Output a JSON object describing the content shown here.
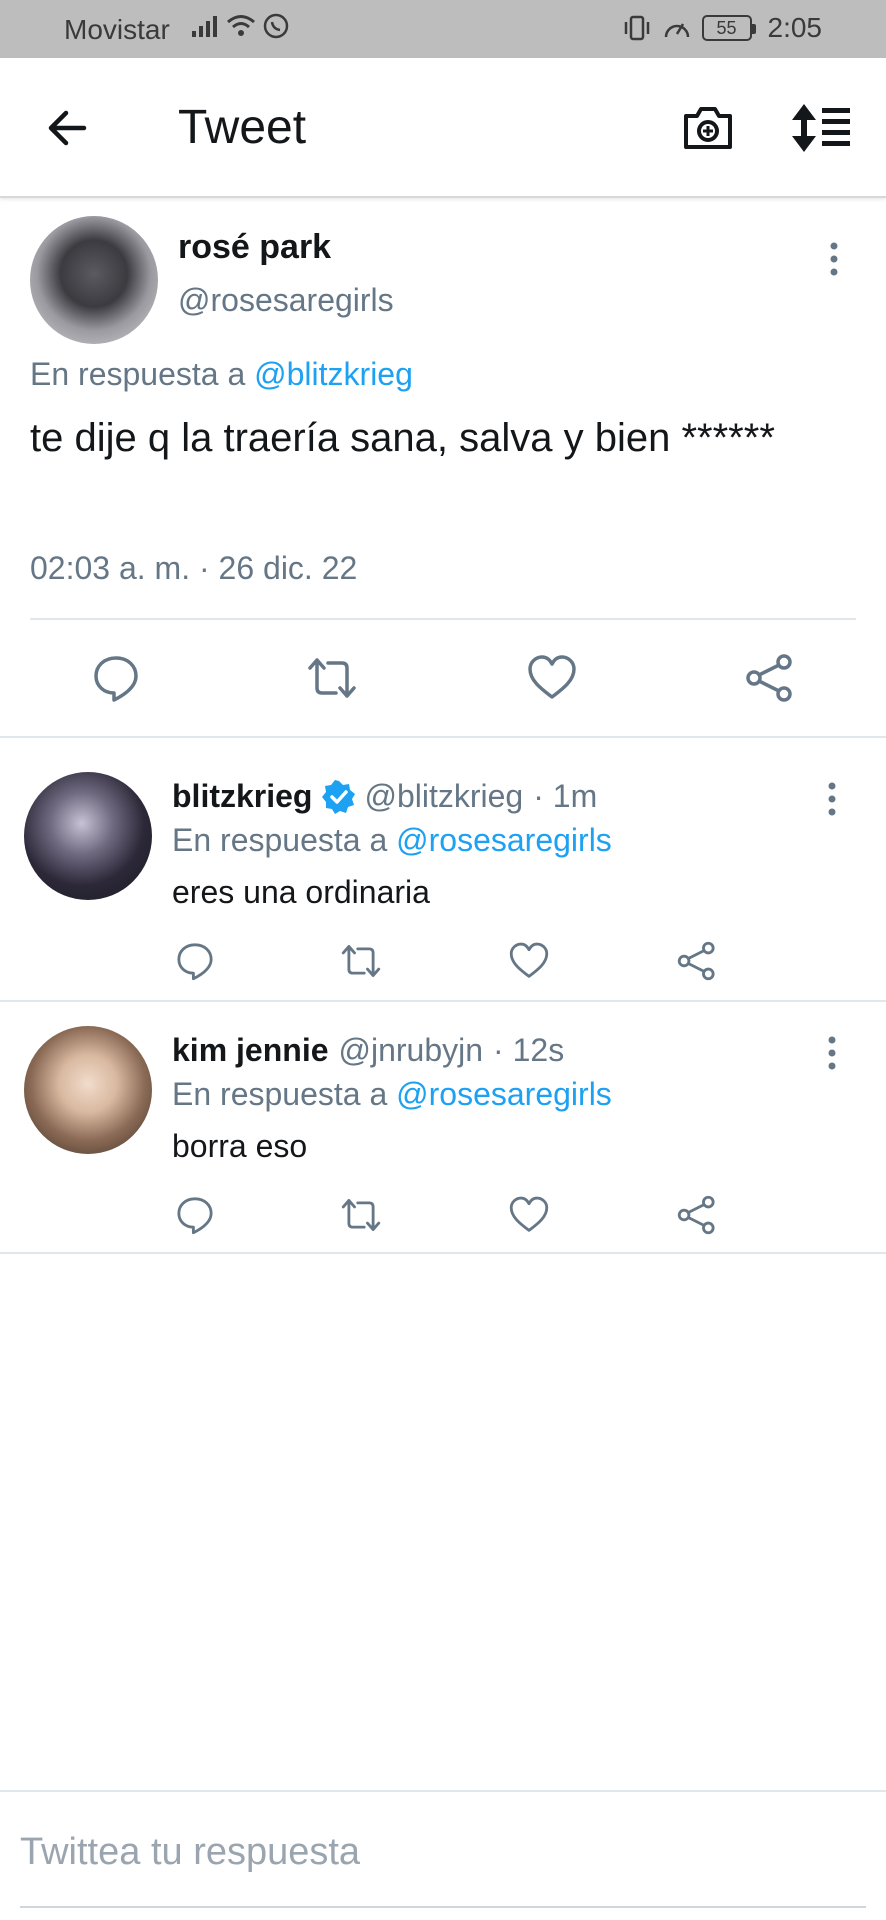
{
  "status_bar": {
    "carrier": "Movistar",
    "battery": "55",
    "time": "2:05",
    "icons": [
      "signal-icon",
      "wifi-icon",
      "whatsapp-icon",
      "vibrate-icon",
      "speed-icon",
      "battery-icon"
    ]
  },
  "header": {
    "title": "Tweet",
    "icons": [
      "back-arrow-icon",
      "camera-icon",
      "sort-icon"
    ]
  },
  "main_tweet": {
    "name": "rosé park",
    "handle": "@rosesaregirls",
    "reply_prefix": "En respuesta a",
    "reply_mention": "@blitzkrieg",
    "text": "te dije q la traería sana, salva y bien ******",
    "timestamp": "02:03 a. m. · 26 dic. 22",
    "actions": [
      "reply-icon",
      "retweet-icon",
      "like-icon",
      "share-icon"
    ]
  },
  "replies": [
    {
      "name": "blitzkrieg",
      "verified": true,
      "handle": "@blitzkrieg",
      "time": "· 1m",
      "reply_prefix": "En respuesta a",
      "reply_mention": "@rosesaregirls",
      "text": "eres una ordinaria"
    },
    {
      "name": "kim jennie",
      "verified": false,
      "handle": "@jnrubyjn",
      "time": "· 12s",
      "reply_prefix": "En respuesta a",
      "reply_mention": "@rosesaregirls",
      "text": "borra eso"
    }
  ],
  "compose": {
    "placeholder": "Twittea tu respuesta"
  },
  "colors": {
    "accent": "#1da1f2",
    "secondary_text": "#657786",
    "status_bar": "#bdbdbd"
  }
}
